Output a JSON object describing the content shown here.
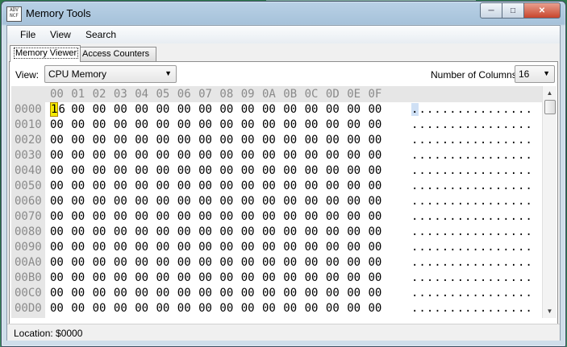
{
  "window": {
    "title": "Memory Tools",
    "icon_text": "ADV NCF"
  },
  "menu": [
    "File",
    "View",
    "Search"
  ],
  "tabs": [
    "Memory Viewer",
    "Access Counters"
  ],
  "toolbar": {
    "view_label": "View:",
    "view_value": "CPU Memory",
    "columns_label": "Number of Columns:",
    "columns_value": "16"
  },
  "hex": {
    "header": [
      "00",
      "01",
      "02",
      "03",
      "04",
      "05",
      "06",
      "07",
      "08",
      "09",
      "0A",
      "0B",
      "0C",
      "0D",
      "0E",
      "0F"
    ],
    "rows": [
      {
        "addr": "0000",
        "bytes": [
          "16",
          "00",
          "00",
          "00",
          "00",
          "00",
          "00",
          "00",
          "00",
          "00",
          "00",
          "00",
          "00",
          "00",
          "00",
          "00"
        ],
        "ascii": "................"
      },
      {
        "addr": "0010",
        "bytes": [
          "00",
          "00",
          "00",
          "00",
          "00",
          "00",
          "00",
          "00",
          "00",
          "00",
          "00",
          "00",
          "00",
          "00",
          "00",
          "00"
        ],
        "ascii": "................"
      },
      {
        "addr": "0020",
        "bytes": [
          "00",
          "00",
          "00",
          "00",
          "00",
          "00",
          "00",
          "00",
          "00",
          "00",
          "00",
          "00",
          "00",
          "00",
          "00",
          "00"
        ],
        "ascii": "................"
      },
      {
        "addr": "0030",
        "bytes": [
          "00",
          "00",
          "00",
          "00",
          "00",
          "00",
          "00",
          "00",
          "00",
          "00",
          "00",
          "00",
          "00",
          "00",
          "00",
          "00"
        ],
        "ascii": "................"
      },
      {
        "addr": "0040",
        "bytes": [
          "00",
          "00",
          "00",
          "00",
          "00",
          "00",
          "00",
          "00",
          "00",
          "00",
          "00",
          "00",
          "00",
          "00",
          "00",
          "00"
        ],
        "ascii": "................"
      },
      {
        "addr": "0050",
        "bytes": [
          "00",
          "00",
          "00",
          "00",
          "00",
          "00",
          "00",
          "00",
          "00",
          "00",
          "00",
          "00",
          "00",
          "00",
          "00",
          "00"
        ],
        "ascii": "................"
      },
      {
        "addr": "0060",
        "bytes": [
          "00",
          "00",
          "00",
          "00",
          "00",
          "00",
          "00",
          "00",
          "00",
          "00",
          "00",
          "00",
          "00",
          "00",
          "00",
          "00"
        ],
        "ascii": "................"
      },
      {
        "addr": "0070",
        "bytes": [
          "00",
          "00",
          "00",
          "00",
          "00",
          "00",
          "00",
          "00",
          "00",
          "00",
          "00",
          "00",
          "00",
          "00",
          "00",
          "00"
        ],
        "ascii": "................"
      },
      {
        "addr": "0080",
        "bytes": [
          "00",
          "00",
          "00",
          "00",
          "00",
          "00",
          "00",
          "00",
          "00",
          "00",
          "00",
          "00",
          "00",
          "00",
          "00",
          "00"
        ],
        "ascii": "................"
      },
      {
        "addr": "0090",
        "bytes": [
          "00",
          "00",
          "00",
          "00",
          "00",
          "00",
          "00",
          "00",
          "00",
          "00",
          "00",
          "00",
          "00",
          "00",
          "00",
          "00"
        ],
        "ascii": "................"
      },
      {
        "addr": "00A0",
        "bytes": [
          "00",
          "00",
          "00",
          "00",
          "00",
          "00",
          "00",
          "00",
          "00",
          "00",
          "00",
          "00",
          "00",
          "00",
          "00",
          "00"
        ],
        "ascii": "................"
      },
      {
        "addr": "00B0",
        "bytes": [
          "00",
          "00",
          "00",
          "00",
          "00",
          "00",
          "00",
          "00",
          "00",
          "00",
          "00",
          "00",
          "00",
          "00",
          "00",
          "00"
        ],
        "ascii": "................"
      },
      {
        "addr": "00C0",
        "bytes": [
          "00",
          "00",
          "00",
          "00",
          "00",
          "00",
          "00",
          "00",
          "00",
          "00",
          "00",
          "00",
          "00",
          "00",
          "00",
          "00"
        ],
        "ascii": "................"
      },
      {
        "addr": "00D0",
        "bytes": [
          "00",
          "00",
          "00",
          "00",
          "00",
          "00",
          "00",
          "00",
          "00",
          "00",
          "00",
          "00",
          "00",
          "00",
          "00",
          "00"
        ],
        "ascii": "................"
      }
    ]
  },
  "status": {
    "location": "Location: $0000"
  },
  "colors": {
    "cursor_highlight": "#f5ea00",
    "address_fg": "#8a8a8a"
  }
}
